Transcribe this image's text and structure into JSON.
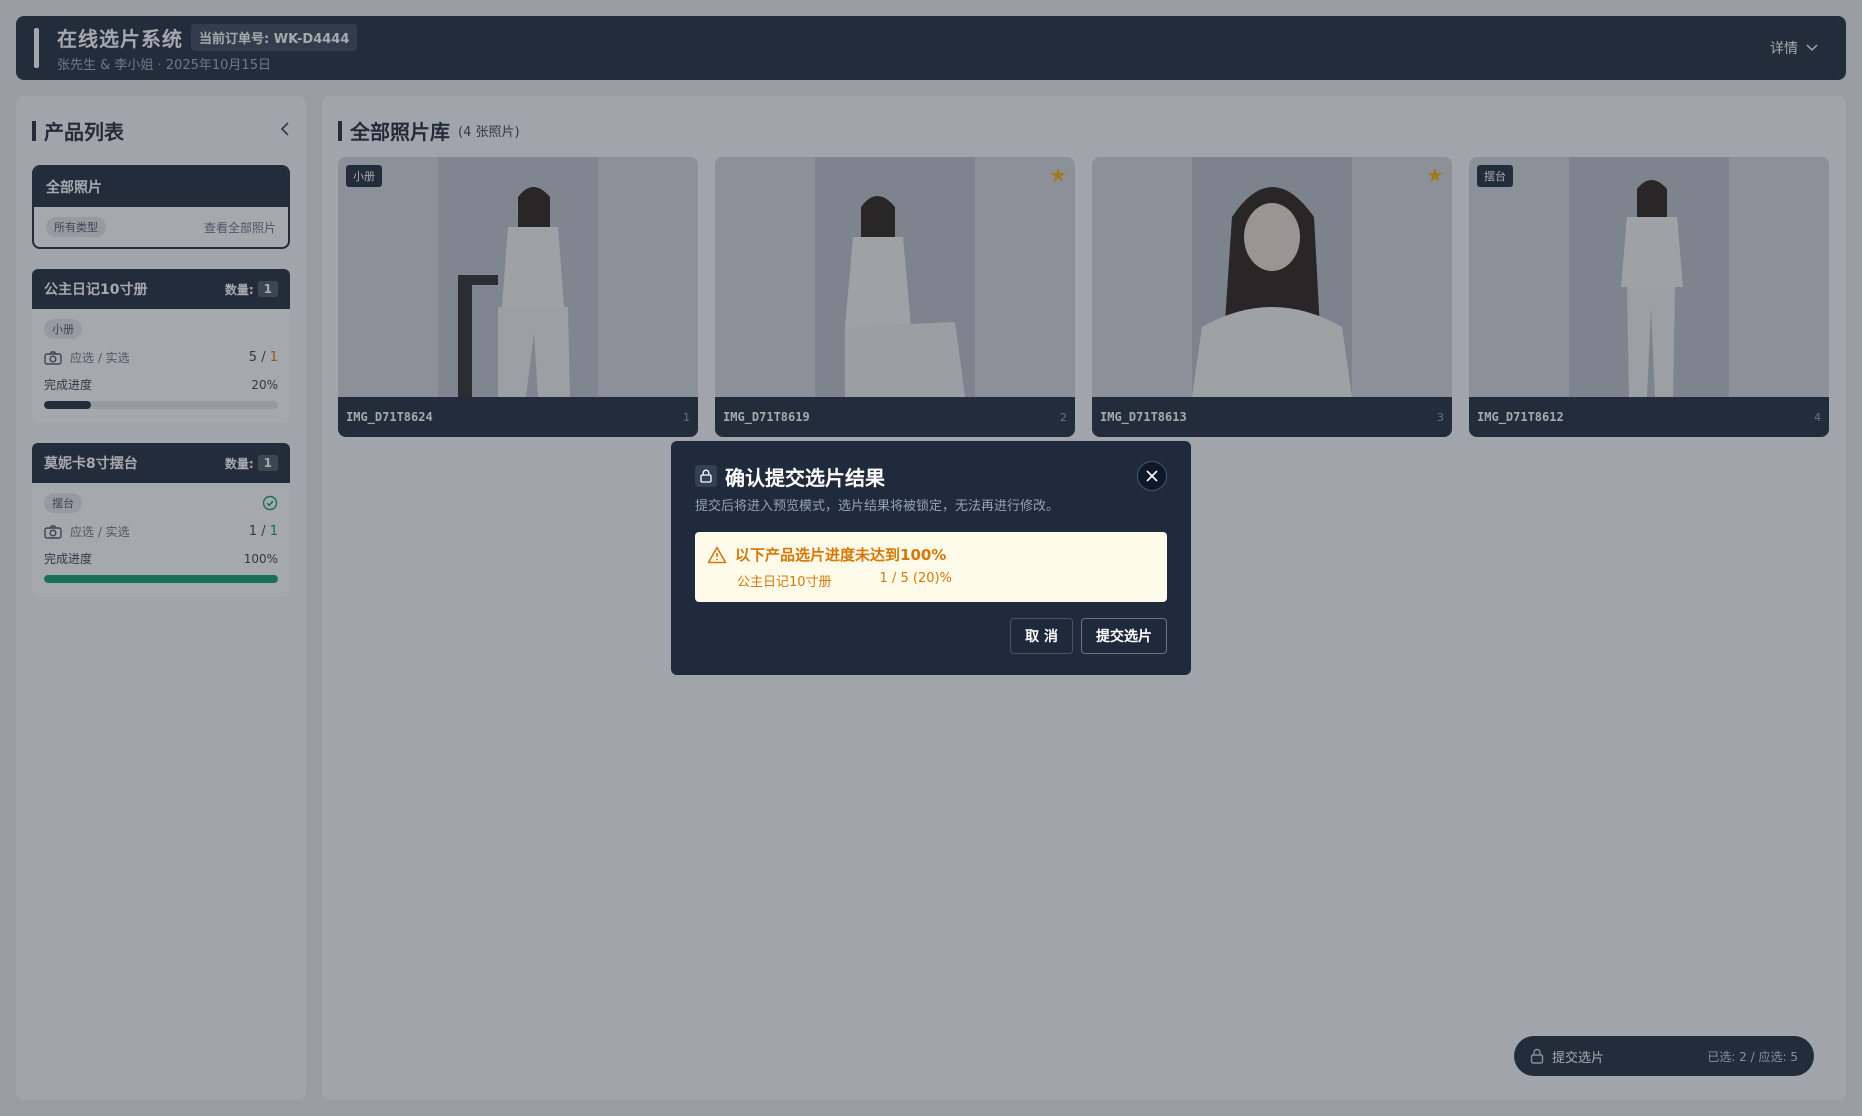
{
  "header": {
    "app_title": "在线选片系统",
    "order_badge": "当前订单号: WK-D4444",
    "subtitle": "张先生 & 李小姐 · 2025年10月15日",
    "details_label": "详情"
  },
  "sidebar": {
    "title": "产品列表",
    "all_photos": {
      "title": "全部照片",
      "tag": "所有类型",
      "link": "查看全部照片"
    },
    "products": [
      {
        "name": "公主日记10寸册",
        "qty_label": "数量:",
        "qty": "1",
        "tag": "小册",
        "select_label": "应选 / 实选",
        "required": "5",
        "separator": "/",
        "selected": "1",
        "progress_label": "完成进度",
        "progress_text": "20%",
        "progress": 0.2,
        "progress_color": "#1f2a3c",
        "complete": false
      },
      {
        "name": "莫妮卡8寸摆台",
        "qty_label": "数量:",
        "qty": "1",
        "tag": "摆台",
        "select_label": "应选 / 实选",
        "required": "1",
        "separator": "/",
        "selected": "1",
        "progress_label": "完成进度",
        "progress_text": "100%",
        "progress": 1.0,
        "progress_color": "#0f9d6b",
        "complete": true
      }
    ]
  },
  "main": {
    "title": "全部照片库",
    "count": "(4 张照片)",
    "photos": [
      {
        "filename": "IMG_D71T8624",
        "index": "1",
        "tag": "小册",
        "starred": false,
        "pose": "sitting-stool"
      },
      {
        "filename": "IMG_D71T8619",
        "index": "2",
        "tag": "",
        "starred": true,
        "pose": "sitting-chair"
      },
      {
        "filename": "IMG_D71T8613",
        "index": "3",
        "tag": "",
        "starred": true,
        "pose": "portrait"
      },
      {
        "filename": "IMG_D71T8612",
        "index": "4",
        "tag": "摆台",
        "starred": false,
        "pose": "standing"
      }
    ]
  },
  "submit_bar": {
    "label": "提交选片",
    "status": "已选: 2 / 应选: 5"
  },
  "modal": {
    "title": "确认提交选片结果",
    "subtitle": "提交后将进入预览模式，选片结果将被锁定，无法再进行修改。",
    "warning_title": "以下产品选片进度未达到100%",
    "warning_items": [
      {
        "name": "公主日记10寸册",
        "progress": "1 / 5 (20)%"
      }
    ],
    "cancel_label": "取 消",
    "submit_label": "提交选片"
  },
  "colors": {
    "brand_dark": "#1f2a3c",
    "warning": "#d97706",
    "star": "#f5b301",
    "success": "#0f9d6b"
  }
}
